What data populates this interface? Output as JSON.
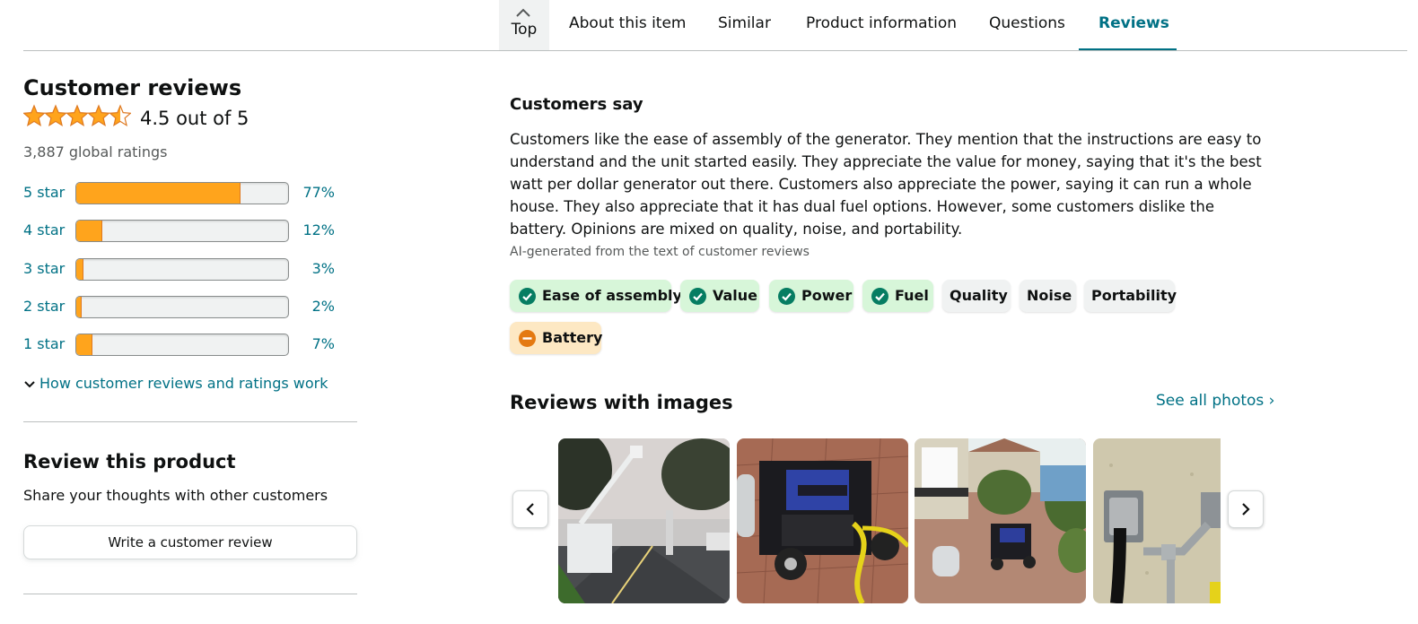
{
  "nav": {
    "top_label": "Top",
    "tabs": [
      "About this item",
      "Similar",
      "Product information",
      "Questions",
      "Reviews"
    ],
    "active_tab": "Reviews"
  },
  "reviews": {
    "heading": "Customer reviews",
    "rating_text": "4.5 out of 5",
    "rating_value": 4.5,
    "global_ratings": "3,887 global ratings",
    "histogram": [
      {
        "label": "5 star",
        "pct_text": "77%",
        "pct": 77
      },
      {
        "label": "4 star",
        "pct_text": "12%",
        "pct": 12
      },
      {
        "label": "3 star",
        "pct_text": "3%",
        "pct": 3
      },
      {
        "label": "2 star",
        "pct_text": "2%",
        "pct": 2
      },
      {
        "label": "1 star",
        "pct_text": "7%",
        "pct": 7
      }
    ],
    "how_link": "How customer reviews and ratings work"
  },
  "review_product": {
    "heading": "Review this product",
    "subtext": "Share your thoughts with other customers",
    "button": "Write a customer review"
  },
  "customers_say": {
    "heading": "Customers say",
    "summary": "Customers like the ease of assembly of the generator. They mention that the instructions are easy to understand and the unit started easily. They appreciate the value for money, saying that it's the best watt per dollar generator out there. Customers also appreciate the power, saying it can run a whole house. They also appreciate that it has dual fuel options. However, some customers dislike the battery. Opinions are mixed on quality, noise, and portability.",
    "ai_note": "AI-generated from the text of customer reviews",
    "chips": [
      {
        "label": "Ease of assembly",
        "sentiment": "positive"
      },
      {
        "label": "Value",
        "sentiment": "positive"
      },
      {
        "label": "Power",
        "sentiment": "positive"
      },
      {
        "label": "Fuel",
        "sentiment": "positive"
      },
      {
        "label": "Quality",
        "sentiment": "mixed"
      },
      {
        "label": "Noise",
        "sentiment": "mixed"
      },
      {
        "label": "Portability",
        "sentiment": "mixed"
      },
      {
        "label": "Battery",
        "sentiment": "negative"
      }
    ]
  },
  "images": {
    "heading": "Reviews with images",
    "see_all": "See all photos ›",
    "photos": [
      "utility-bucket-trucks-photo",
      "generator-on-pavers-photo",
      "generator-with-propane-tank-photo",
      "outlet-on-wall-photo"
    ]
  },
  "colors": {
    "accent": "#007185",
    "star": "#ffa41c",
    "positive_chip": "#d7f6d9",
    "positive_icon": "#067d62",
    "negative_chip": "#fde8c3",
    "negative_icon": "#e47911",
    "neutral_chip": "#f0f2f2"
  }
}
